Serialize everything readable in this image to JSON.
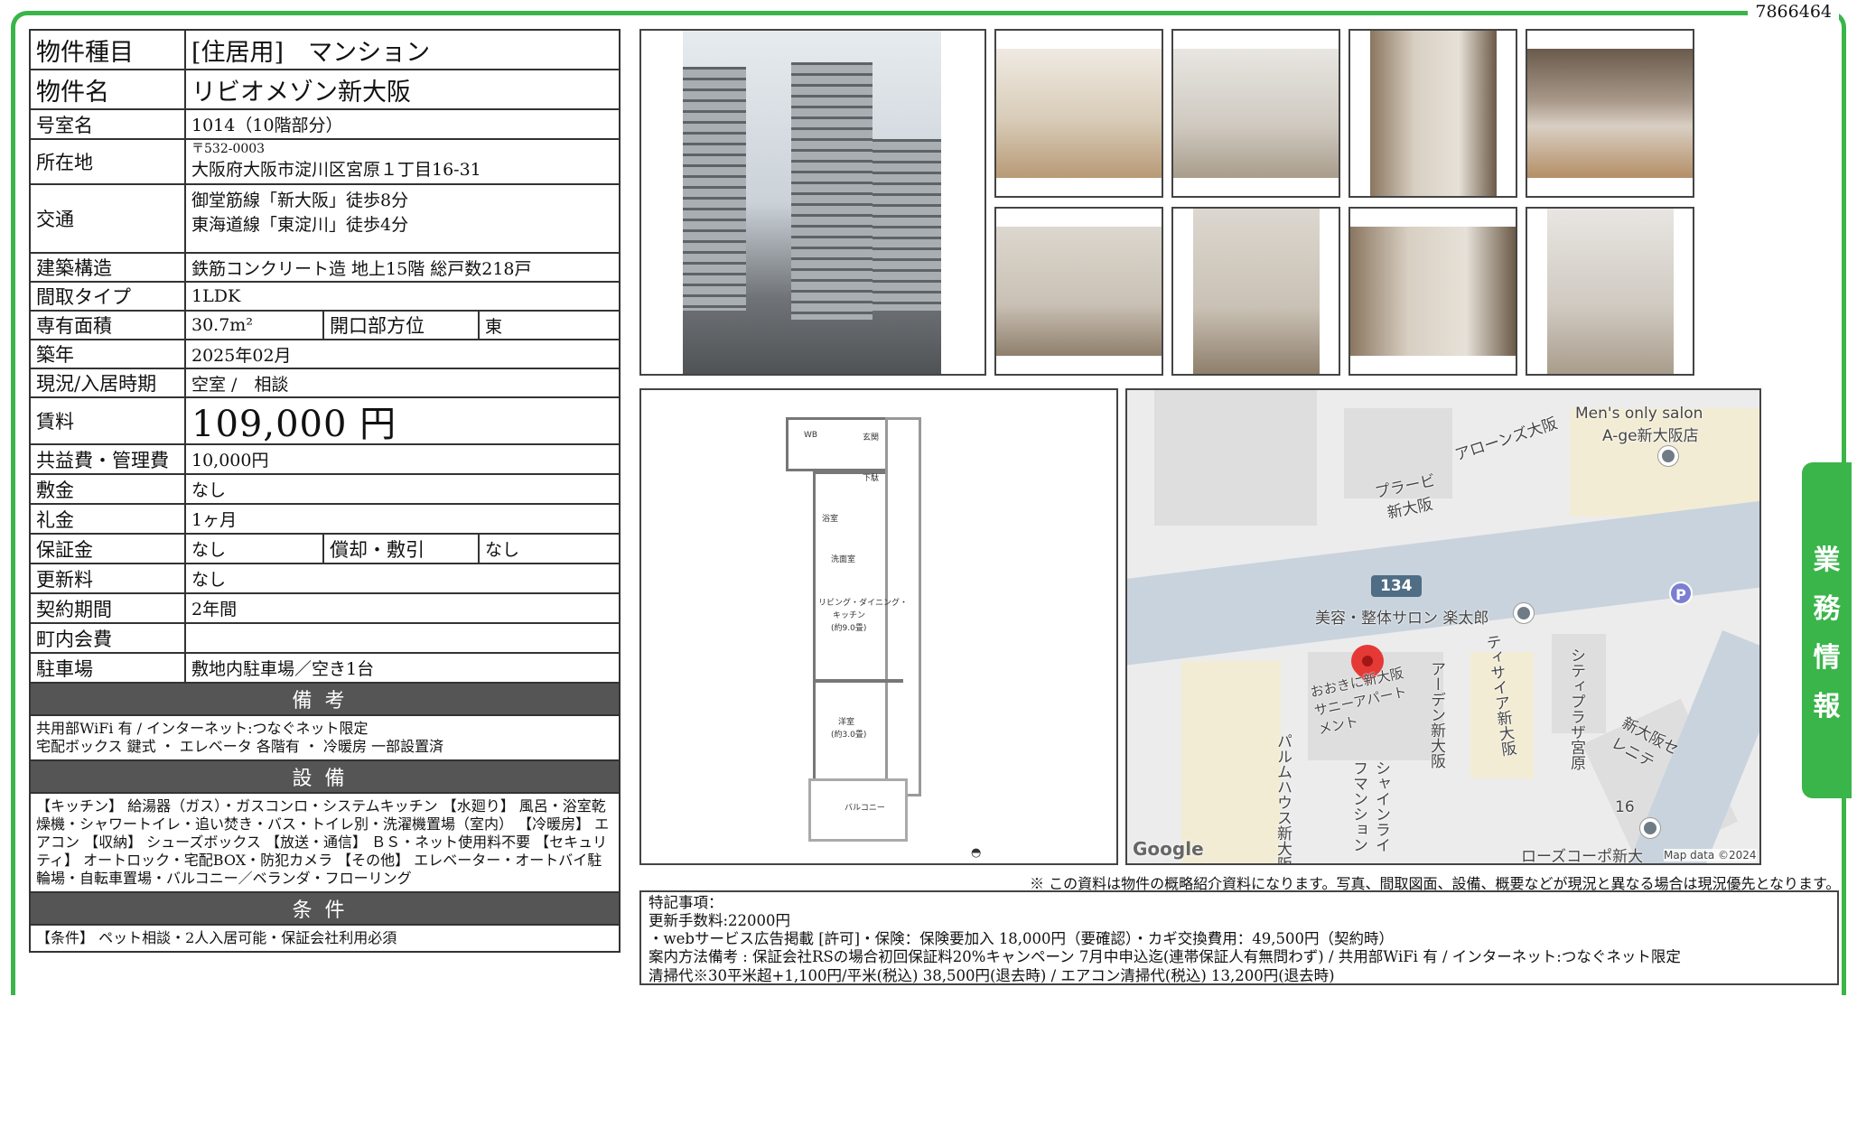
{
  "doc_id": "7866464",
  "spec": {
    "type_label": "物件種目",
    "type_value": "[住居用]　マンション",
    "name_label": "物件名",
    "name_value": "リビオメゾン新大阪",
    "room_label": "号室名",
    "room_value": "1014（10階部分）",
    "address_label": "所在地",
    "postal": "〒532-0003",
    "address_value": "大阪府大阪市淀川区宮原１丁目16-31",
    "transport_label": "交通",
    "transport_1": "御堂筋線「新大阪」徒歩8分",
    "transport_2": "東海道線「東淀川」徒歩4分",
    "structure_label": "建築構造",
    "structure_value": "鉄筋コンクリート造 地上15階 総戸数218戸",
    "layout_label": "間取タイプ",
    "layout_value": "1LDK",
    "area_label": "専有面積",
    "area_value": "30.7m²",
    "opening_label": "開口部方位",
    "opening_value": "東",
    "built_label": "築年",
    "built_value": "2025年02月",
    "status_label": "現況/入居時期",
    "status_value": "空室 /　相談",
    "rent_label": "賃料",
    "rent_value": "109,000 円",
    "fee_label": "共益費・管理費",
    "fee_value": "10,000円",
    "deposit_label": "敷金",
    "deposit_value": "なし",
    "keymoney_label": "礼金",
    "keymoney_value": "1ヶ月",
    "guarantee_label": "保証金",
    "guarantee_value": "なし",
    "amort_label": "償却・敷引",
    "amort_value": "なし",
    "renewal_label": "更新料",
    "renewal_value": "なし",
    "contract_label": "契約期間",
    "contract_value": "2年間",
    "town_label": "町内会費",
    "town_value": "",
    "parking_label": "駐車場",
    "parking_value": "敷地内駐車場／空き1台",
    "remarks_title": "備考",
    "remarks_1": "共用部WiFi 有 /  インターネット:つなぐネット限定",
    "remarks_2": "宅配ボックス 鍵式 ・ エレベータ 各階有 ・ 冷暖房 一部設置済",
    "equipment_title": "設備",
    "equipment_text": "【キッチン】 給湯器（ガス）・ガスコンロ・システムキッチン 【水廻り】 風呂・浴室乾燥機・シャワートイレ・追い焚き・バス・トイレ別・洗濯機置場（室内） 【冷暖房】 エアコン 【収納】 シューズボックス 【放送・通信】 ＢＳ・ネット使用料不要 【セキュリティ】 オートロック・宅配BOX・防犯カメラ 【その他】 エレベーター・オートバイ駐輪場・自転車置場・バルコニー／ベランダ・フローリング",
    "conditions_title": "条件",
    "conditions_text": "【条件】 ペット相談・2人入居可能・保証会社利用必須"
  },
  "floorplan": {
    "wc": "WB",
    "entrance": "玄関",
    "shoes": "下駄",
    "bath": "浴室",
    "washroom": "洗面室",
    "ldk_1": "リビング・ダイニング・",
    "ldk_2": "キッチン",
    "ldk_3": "(約9.0畳)",
    "bed_1": "洋室",
    "bed_2": "(約3.0畳)",
    "balcony": "バルコニー"
  },
  "map": {
    "label_1": "Men's only salon",
    "label_2": "A-ge新大阪店",
    "label_3": "アローンズ大阪",
    "label_4": "プラービ新大阪",
    "route": "134",
    "label_5": "美容・整体サロン 楽太郎",
    "label_6": "おおきに新大阪サニーアパートメント",
    "label_7": "アーデン新大阪",
    "label_8": "ティサイア新大阪",
    "label_9": "シティプラザ宮原",
    "label_10": "新大阪セレニテ",
    "label_11": "パルムハウス新大阪",
    "label_12": "シャインライフマンション",
    "label_13": "ローズコーポ新大",
    "block_num": "16",
    "parking": "P",
    "google": "Google",
    "mapdata": "Map data ©2024"
  },
  "note": "※ この資料は物件の概略紹介資料になります。写真、間取図面、設備、概要などが現況と異なる場合は現況優先となります。",
  "remarks_box": {
    "line_1": "特記事項：",
    "line_2": "更新手数料:22000円",
    "line_3": "・webサービス広告掲載 [許可]・保険：保険要加入 18,000円（要確認）・カギ交換費用：49,500円（契約時）",
    "line_4": "案内方法備考 :  保証会社RSの場合初回保証料20%キャンペーン 7月中申込迄(連帯保証人有無問わず) /  共用部WiFi 有 /  インターネット:つなぐネット限定",
    "line_5": "清掃代※30平米超+1,100円/平米(税込) 38,500円(退去時) /  エアコン清掃代(税込) 13,200円(退去時)"
  },
  "side_tab": [
    "業",
    "務",
    "情",
    "報"
  ],
  "colors": {
    "accent_green": "#3ab54a",
    "section_gray": "#555555",
    "pin_red": "#e53935"
  }
}
